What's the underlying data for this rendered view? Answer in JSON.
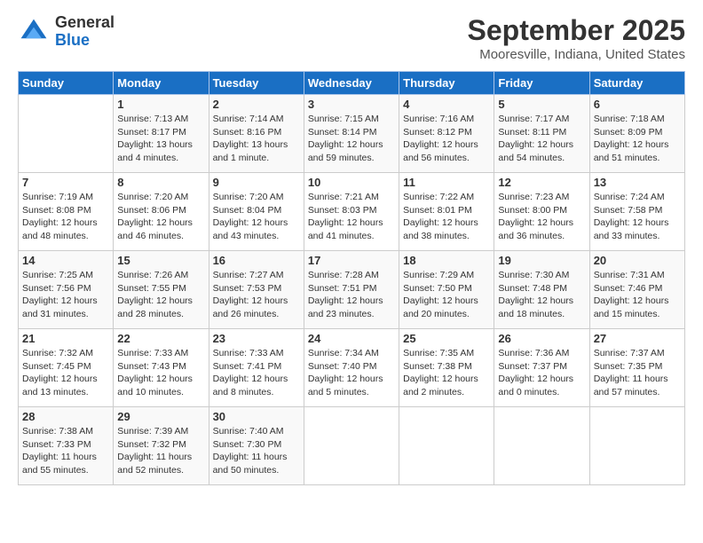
{
  "header": {
    "logo": {
      "general": "General",
      "blue": "Blue"
    },
    "title": "September 2025",
    "location": "Mooresville, Indiana, United States"
  },
  "days_of_week": [
    "Sunday",
    "Monday",
    "Tuesday",
    "Wednesday",
    "Thursday",
    "Friday",
    "Saturday"
  ],
  "weeks": [
    [
      {
        "day": "",
        "info": ""
      },
      {
        "day": "1",
        "info": "Sunrise: 7:13 AM\nSunset: 8:17 PM\nDaylight: 13 hours\nand 4 minutes."
      },
      {
        "day": "2",
        "info": "Sunrise: 7:14 AM\nSunset: 8:16 PM\nDaylight: 13 hours\nand 1 minute."
      },
      {
        "day": "3",
        "info": "Sunrise: 7:15 AM\nSunset: 8:14 PM\nDaylight: 12 hours\nand 59 minutes."
      },
      {
        "day": "4",
        "info": "Sunrise: 7:16 AM\nSunset: 8:12 PM\nDaylight: 12 hours\nand 56 minutes."
      },
      {
        "day": "5",
        "info": "Sunrise: 7:17 AM\nSunset: 8:11 PM\nDaylight: 12 hours\nand 54 minutes."
      },
      {
        "day": "6",
        "info": "Sunrise: 7:18 AM\nSunset: 8:09 PM\nDaylight: 12 hours\nand 51 minutes."
      }
    ],
    [
      {
        "day": "7",
        "info": "Sunrise: 7:19 AM\nSunset: 8:08 PM\nDaylight: 12 hours\nand 48 minutes."
      },
      {
        "day": "8",
        "info": "Sunrise: 7:20 AM\nSunset: 8:06 PM\nDaylight: 12 hours\nand 46 minutes."
      },
      {
        "day": "9",
        "info": "Sunrise: 7:20 AM\nSunset: 8:04 PM\nDaylight: 12 hours\nand 43 minutes."
      },
      {
        "day": "10",
        "info": "Sunrise: 7:21 AM\nSunset: 8:03 PM\nDaylight: 12 hours\nand 41 minutes."
      },
      {
        "day": "11",
        "info": "Sunrise: 7:22 AM\nSunset: 8:01 PM\nDaylight: 12 hours\nand 38 minutes."
      },
      {
        "day": "12",
        "info": "Sunrise: 7:23 AM\nSunset: 8:00 PM\nDaylight: 12 hours\nand 36 minutes."
      },
      {
        "day": "13",
        "info": "Sunrise: 7:24 AM\nSunset: 7:58 PM\nDaylight: 12 hours\nand 33 minutes."
      }
    ],
    [
      {
        "day": "14",
        "info": "Sunrise: 7:25 AM\nSunset: 7:56 PM\nDaylight: 12 hours\nand 31 minutes."
      },
      {
        "day": "15",
        "info": "Sunrise: 7:26 AM\nSunset: 7:55 PM\nDaylight: 12 hours\nand 28 minutes."
      },
      {
        "day": "16",
        "info": "Sunrise: 7:27 AM\nSunset: 7:53 PM\nDaylight: 12 hours\nand 26 minutes."
      },
      {
        "day": "17",
        "info": "Sunrise: 7:28 AM\nSunset: 7:51 PM\nDaylight: 12 hours\nand 23 minutes."
      },
      {
        "day": "18",
        "info": "Sunrise: 7:29 AM\nSunset: 7:50 PM\nDaylight: 12 hours\nand 20 minutes."
      },
      {
        "day": "19",
        "info": "Sunrise: 7:30 AM\nSunset: 7:48 PM\nDaylight: 12 hours\nand 18 minutes."
      },
      {
        "day": "20",
        "info": "Sunrise: 7:31 AM\nSunset: 7:46 PM\nDaylight: 12 hours\nand 15 minutes."
      }
    ],
    [
      {
        "day": "21",
        "info": "Sunrise: 7:32 AM\nSunset: 7:45 PM\nDaylight: 12 hours\nand 13 minutes."
      },
      {
        "day": "22",
        "info": "Sunrise: 7:33 AM\nSunset: 7:43 PM\nDaylight: 12 hours\nand 10 minutes."
      },
      {
        "day": "23",
        "info": "Sunrise: 7:33 AM\nSunset: 7:41 PM\nDaylight: 12 hours\nand 8 minutes."
      },
      {
        "day": "24",
        "info": "Sunrise: 7:34 AM\nSunset: 7:40 PM\nDaylight: 12 hours\nand 5 minutes."
      },
      {
        "day": "25",
        "info": "Sunrise: 7:35 AM\nSunset: 7:38 PM\nDaylight: 12 hours\nand 2 minutes."
      },
      {
        "day": "26",
        "info": "Sunrise: 7:36 AM\nSunset: 7:37 PM\nDaylight: 12 hours\nand 0 minutes."
      },
      {
        "day": "27",
        "info": "Sunrise: 7:37 AM\nSunset: 7:35 PM\nDaylight: 11 hours\nand 57 minutes."
      }
    ],
    [
      {
        "day": "28",
        "info": "Sunrise: 7:38 AM\nSunset: 7:33 PM\nDaylight: 11 hours\nand 55 minutes."
      },
      {
        "day": "29",
        "info": "Sunrise: 7:39 AM\nSunset: 7:32 PM\nDaylight: 11 hours\nand 52 minutes."
      },
      {
        "day": "30",
        "info": "Sunrise: 7:40 AM\nSunset: 7:30 PM\nDaylight: 11 hours\nand 50 minutes."
      },
      {
        "day": "",
        "info": ""
      },
      {
        "day": "",
        "info": ""
      },
      {
        "day": "",
        "info": ""
      },
      {
        "day": "",
        "info": ""
      }
    ]
  ]
}
